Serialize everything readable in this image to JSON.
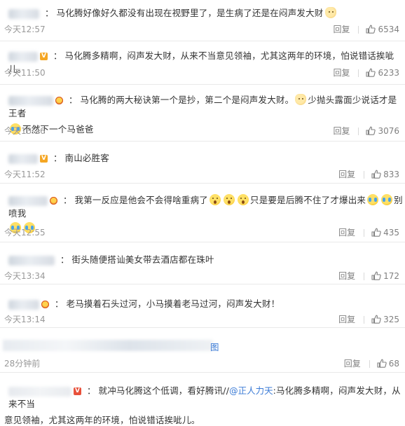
{
  "comments": [
    {
      "text": "马化腾好像好久都没有出现在视野里了，是生病了还是在闷声发大财",
      "time": "今天12:57",
      "reply_label": "回复",
      "likes": "6534"
    },
    {
      "text": "马化腾多精啊，闷声发大财，从来不当意见领袖，尤其这两年的环境，怕说错话挨呲儿。",
      "time": "今天11:50",
      "reply_label": "回复",
      "likes": "6233"
    },
    {
      "text_part1": "马化腾的两大秘诀第一个是抄，第二个是闷声发大财。",
      "text_part2": "少抛头露面少说话才是王者",
      "text_part3": "不然下一个马爸爸",
      "time": "今天13:26",
      "reply_label": "回复",
      "likes": "3076"
    },
    {
      "text": "南山必胜客",
      "time": "今天11:52",
      "reply_label": "回复",
      "likes": "833"
    },
    {
      "text_part1": "我第一反应是他会不会得啥重病了",
      "text_part2": "只是要是后腾不住了才爆出来",
      "text_part3": "别喷我",
      "time": "今天12:55",
      "reply_label": "回复",
      "likes": "435"
    },
    {
      "text": "街头随便搭讪美女带去酒店都在珠叶",
      "time": "今天13:34",
      "reply_label": "回复",
      "likes": "172"
    },
    {
      "text": "老马摸着石头过河，小马摸着老马过河，闷声发大财！",
      "time": "今天13:14",
      "reply_label": "回复",
      "likes": "325"
    },
    {
      "text_tail": "图",
      "time": "28分钟前",
      "reply_label": "回复",
      "likes": "68"
    },
    {
      "text_part1": "就冲马化腾这个低调，看好腾讯//",
      "mention": "@正人力天",
      "text_part2": ":马化腾多精啊，闷声发大财，从来不当",
      "text_part3": "意见领袖，尤其这两年的环境，怕说错话挨呲儿。"
    }
  ],
  "icons": {
    "thumb": "thumbs-up-icon",
    "verified": "verified-v-icon",
    "crown": "crown-badge-icon",
    "emoji_cat": "cat-face-emoji",
    "emoji_cry": "laugh-cry-emoji",
    "emoji_shock": "shocked-face-emoji"
  },
  "colors": {
    "text": "#333333",
    "meta": "#999999",
    "link": "#3b7bd6",
    "divider": "#e9e9e9",
    "badge_orange": "#f5a623",
    "badge_red": "#e8503a"
  }
}
